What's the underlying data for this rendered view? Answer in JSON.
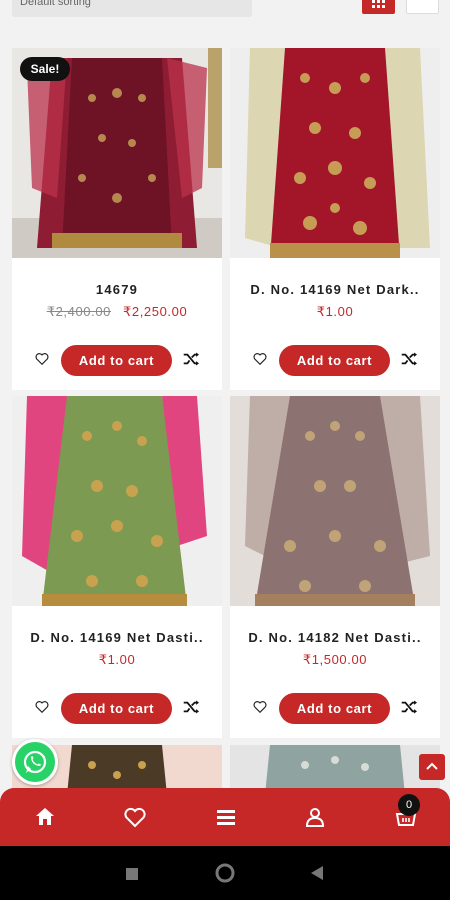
{
  "toolbar": {
    "sort_label": "Default sorting",
    "grid_view_icon": "grid-icon",
    "list_view_icon": "list-icon"
  },
  "products": [
    {
      "title": "14679",
      "old_price": "₹2,400.00",
      "price": "₹2,250.00",
      "badge": "Sale!",
      "add_to_cart": "Add to cart",
      "image": "maroon-lehenga"
    },
    {
      "title": "D. No. 14169 Net Dark..",
      "price": "₹1.00",
      "add_to_cart": "Add to cart",
      "image": "red-lehenga"
    },
    {
      "title": "D. No. 14169 Net Dasti..",
      "price": "₹1.00",
      "add_to_cart": "Add to cart",
      "image": "green-pink-lehenga"
    },
    {
      "title": "D. No. 14182 Net Dasti..",
      "price": "₹1,500.00",
      "add_to_cart": "Add to cart",
      "image": "mauve-lehenga"
    }
  ],
  "bottom_nav": {
    "items": [
      "home-icon",
      "heart-icon",
      "menu-icon",
      "user-icon",
      "cart-icon"
    ],
    "cart_count": "0"
  },
  "colors": {
    "accent": "#c62828",
    "whatsapp": "#27d366",
    "page_bg": "#f2f2f2"
  }
}
